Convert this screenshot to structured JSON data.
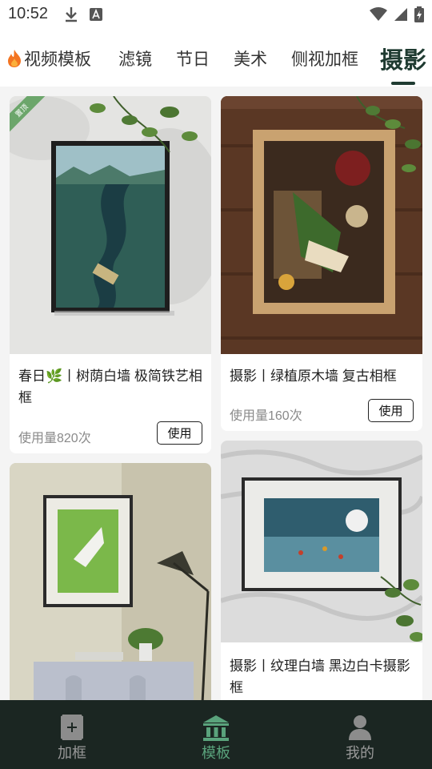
{
  "status_bar": {
    "time": "10:52"
  },
  "tabs": [
    {
      "label": "视频模板",
      "icon": "fire-icon"
    },
    {
      "label": "滤镜"
    },
    {
      "label": "节日"
    },
    {
      "label": "美术"
    },
    {
      "label": "侧视加框"
    },
    {
      "label": "摄影",
      "active": true
    }
  ],
  "cards": [
    {
      "title": "春日🌿丨树荫白墙 极简铁艺相框",
      "usage": "使用量820次",
      "button": "使用",
      "badge": "置顶"
    },
    {
      "title": "摄影丨绿植原木墙 复古相框",
      "usage": "使用量160次",
      "button": "使用"
    },
    {
      "title": ""
    },
    {
      "title": "摄影丨纹理白墙 黑边白卡摄影框"
    }
  ],
  "bottom_nav": [
    {
      "label": "加框",
      "icon": "frame-add-icon"
    },
    {
      "label": "模板",
      "icon": "template-icon",
      "active": true
    },
    {
      "label": "我的",
      "icon": "person-icon"
    }
  ],
  "colors": {
    "accent": "#1f3b31",
    "nav_bg": "#1b2622",
    "nav_active": "#5aa37c"
  }
}
